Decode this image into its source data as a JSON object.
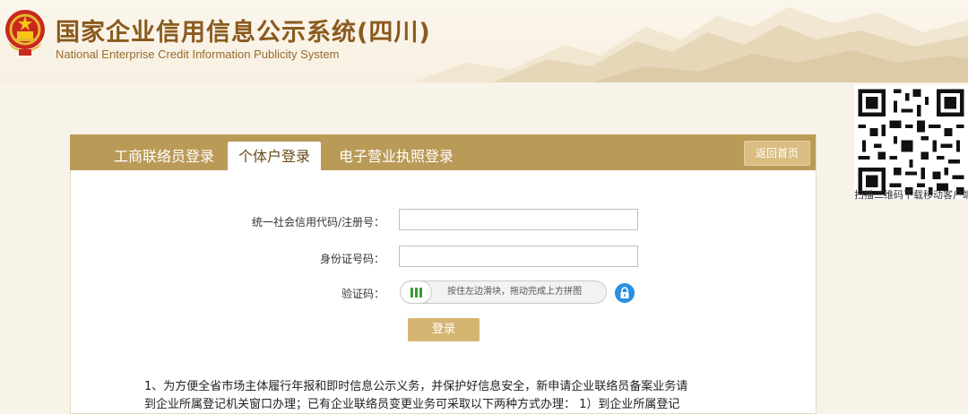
{
  "header": {
    "title_cn": "国家企业信用信息公示系统(四川)",
    "title_en": "National Enterprise Credit Information Publicity System"
  },
  "qr": {
    "caption": "扫描二维码下载移动客户端"
  },
  "tabs": [
    {
      "label": "工商联络员登录",
      "active": false
    },
    {
      "label": "个体户登录",
      "active": true
    },
    {
      "label": "电子营业执照登录",
      "active": false
    }
  ],
  "back_button": "返回首页",
  "form": {
    "code_label": "统一社会信用代码/注册号：",
    "code_value": "",
    "id_label": "身份证号码：",
    "id_value": "",
    "captcha_label": "验证码：",
    "slider_text": "按住左边滑块，拖动完成上方拼图",
    "login_button": "登录"
  },
  "notice": {
    "line1": "1、为方便全省市场主体履行年报和即时信息公示义务，并保护好信息安全，新申请企业联络员备案业务请",
    "line2": "到企业所属登记机关窗口办理；已有企业联络员变更业务可采取以下两种方式办理： 1）到企业所属登记"
  },
  "colors": {
    "tab_bar": "#ba9a57",
    "title": "#8a5a1e",
    "login_button": "#d6b472",
    "lock_icon": "#2b8fe0"
  }
}
